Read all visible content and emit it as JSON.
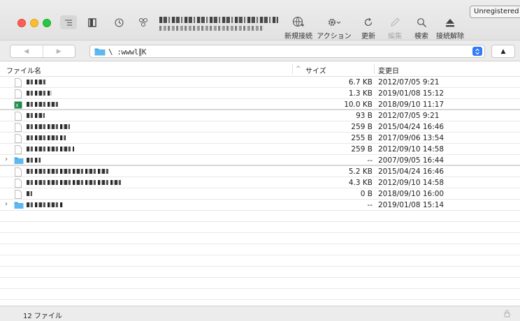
{
  "toolbar": {
    "unregistered_label": "Unregistered",
    "actions": {
      "connect": "新規接続",
      "action": "アクション",
      "refresh": "更新",
      "edit": "編集",
      "search": "検索",
      "disconnect": "接続解除"
    },
    "icons": {
      "outline_view": "outline-view-icon",
      "bookmarks": "bookmark-icon",
      "history": "history-icon",
      "share": "share-icon"
    }
  },
  "pathbar": {
    "back": "◀",
    "forward": "▶",
    "path": "\\ :wwwl∥K",
    "up": "▲"
  },
  "columns": {
    "name": "ファイル名",
    "sort_indicator": "^",
    "size": "サイズ",
    "modified": "変更日"
  },
  "files": [
    {
      "type": "file",
      "size": "6.7 KB",
      "modified": "2012/07/05 9:21"
    },
    {
      "type": "file",
      "size": "1.3 KB",
      "modified": "2019/01/08 15:12"
    },
    {
      "type": "excel",
      "size": "10.0 KB",
      "modified": "2018/09/10 11:17"
    },
    {
      "type": "file",
      "size": "93 B",
      "modified": "2012/07/05 9:21"
    },
    {
      "type": "file",
      "size": "259 B",
      "modified": "2015/04/24 16:46"
    },
    {
      "type": "file",
      "size": "255 B",
      "modified": "2017/09/06 13:54"
    },
    {
      "type": "file",
      "size": "259 B",
      "modified": "2012/09/10 14:58"
    },
    {
      "type": "folder",
      "size": "--",
      "modified": "2007/09/05 16:44"
    },
    {
      "type": "file",
      "size": "5.2 KB",
      "modified": "2015/04/24 16:46"
    },
    {
      "type": "file",
      "size": "4.3 KB",
      "modified": "2012/09/10 14:58"
    },
    {
      "type": "file",
      "size": "0 B",
      "modified": "2018/09/10 16:00"
    },
    {
      "type": "folder",
      "size": "--",
      "modified": "2019/01/08 15:14"
    }
  ],
  "status": {
    "count": "12 ファイル"
  },
  "colors": {
    "accent": "#2f7cf6",
    "folder": "#3fa4e8",
    "close": "#fe5f57",
    "minimize": "#febc2e",
    "maximize": "#28c840"
  }
}
